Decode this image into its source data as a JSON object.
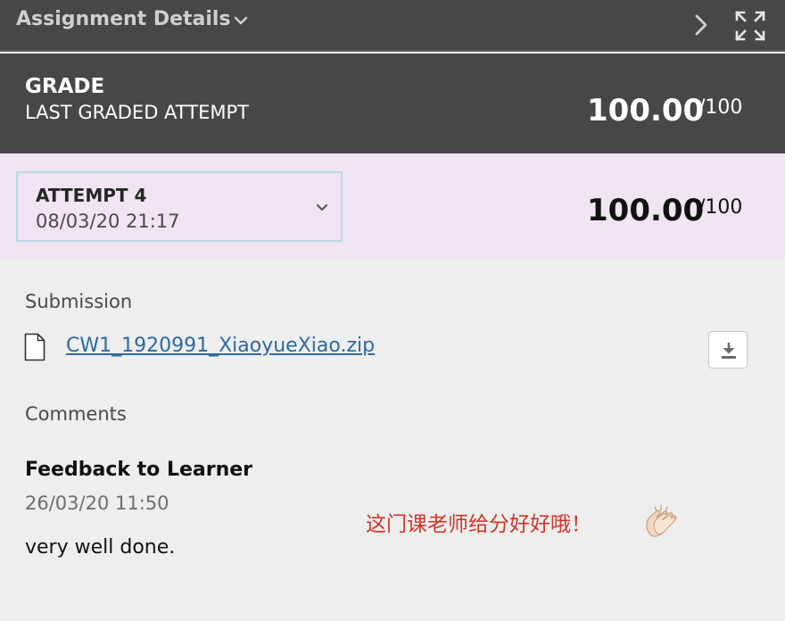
{
  "header": {
    "title": "Assignment Details"
  },
  "grade": {
    "title": "GRADE",
    "subtitle": "LAST GRADED ATTEMPT",
    "score": "100.00",
    "max": "/100"
  },
  "attempt": {
    "label": "ATTEMPT 4",
    "date": "08/03/20 21:17",
    "score": "100.00",
    "max": "/100"
  },
  "submission": {
    "label": "Submission",
    "file_name": "CW1_1920991_XiaoyueXiao.zip"
  },
  "comments": {
    "label": "Comments",
    "feedback_title": "Feedback to Learner",
    "feedback_date": "26/03/20 11:50",
    "feedback_text": "very well done."
  },
  "annotation": {
    "text": "这门课老师给分好好哦！"
  },
  "icons": {
    "header_dropdown": "chevron-down-icon",
    "next": "chevron-right-icon",
    "expand": "expand-icon",
    "attempt_dropdown": "chevron-down-icon",
    "file": "file-icon",
    "download": "download-icon",
    "clap": "clapping-hands-emoji"
  },
  "colors": {
    "header_bg": "#474747",
    "attempt_bg": "#f1e4f3",
    "body_bg": "#eeeeee",
    "link": "#2d6a9f",
    "annotation": "#d0362a"
  }
}
